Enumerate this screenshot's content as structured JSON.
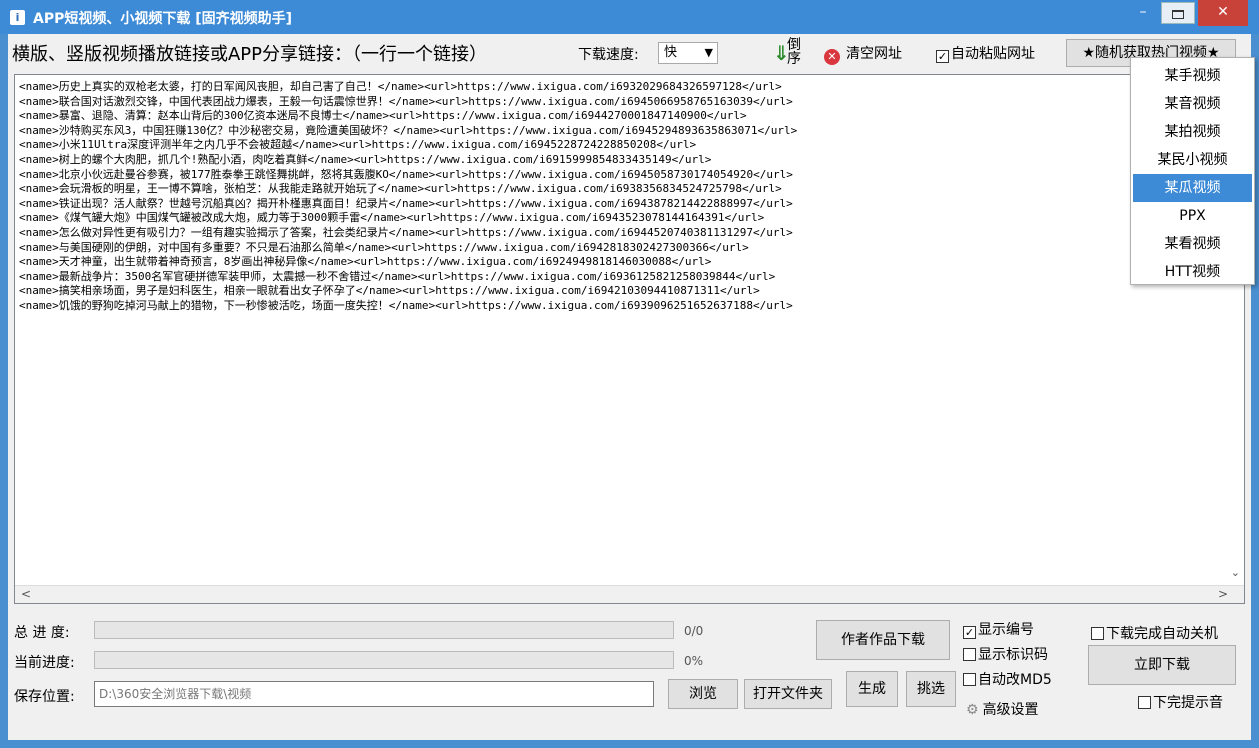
{
  "window": {
    "title": "APP短视频、小视频下载 [固齐视频助手]",
    "min": "–",
    "close": "✕"
  },
  "toolbar": {
    "hint": "横版、竖版视频播放链接或APP分享链接：（一行一个链接）",
    "speed_label": "下载速度:",
    "speed_value": "快",
    "reverse_label": "倒序",
    "clear_label": "清空网址",
    "autopaste_label": "自动粘贴网址",
    "hot_label": "★随机获取热门视频★"
  },
  "links": [
    "<name>历史上真实的双枪老太婆，打的日军闻风丧胆，却自己害了自己！</name><url>https://www.ixigua.com/i6932029684326597128</url>",
    "<name>联合国对话激烈交锋，中国代表团战力爆表，王毅一句话震惊世界！</name><url>https://www.ixigua.com/i6945066958765163039</url>",
    "<name>暴富、退隐、清算：赵本山背后的300亿资本迷局不良博士</name><url>https://www.ixigua.com/i6944270001847140900</url>",
    "<name>沙特购买东风3，中国狂赚130亿？中沙秘密交易，竟险遭美国破坏？</name><url>https://www.ixigua.com/i6945294893635863071</url>",
    "<name>小米11Ultra深度评测半年之内几乎不会被超越</name><url>https://www.ixigua.com/i6945228724228850208</url>",
    "<name>树上的螺个大肉肥，抓几个!熟配小酒，肉吃着真鲜</name><url>https://www.ixigua.com/i6915999854833435149</url>",
    "<name>北京小伙远赴曼谷参赛，被177胜泰拳王跳怪舞挑衅，怒将其轰腹KO</name><url>https://www.ixigua.com/i6945058730174054920</url>",
    "<name>会玩滑板的明星，王一博不算啥，张柏芝：从我能走路就开始玩了</name><url>https://www.ixigua.com/i6938356834524725798</url>",
    "<name>铁证出现？活人献祭？世越号沉船真凶？揭开朴槿惠真面目！纪录片</name><url>https://www.ixigua.com/i6943878214422888997</url>",
    "<name>《煤气罐大炮》中国煤气罐被改成大炮，威力等于3000颗手雷</name><url>https://www.ixigua.com/i6943523078144164391</url>",
    "<name>怎么做对异性更有吸引力？一组有趣实验揭示了答案，社会类纪录片</name><url>https://www.ixigua.com/i6944520740381131297</url>",
    "<name>与美国硬刚的伊朗，对中国有多重要？不只是石油那么简单</name><url>https://www.ixigua.com/i6942818302427300366</url>",
    "<name>天才神童，出生就带着神奇预言，8岁画出神秘异像</name><url>https://www.ixigua.com/i6924949818146030088</url>",
    "<name>最新战争片：3500名军官硬拼德军装甲师，太震撼一秒不舍错过</name><url>https://www.ixigua.com/i6936125821258039844</url>",
    "<name>搞笑相亲场面，男子是妇科医生，相亲一眼就看出女子怀孕了</name><url>https://www.ixigua.com/i6942103094410871311</url>",
    "<name>饥饿的野狗吃掉河马献上的猎物，下一秒惨被活吃，场面一度失控！</name><url>https://www.ixigua.com/i6939096251652637188</url>"
  ],
  "progress": {
    "total_label": "总 进 度:",
    "total_value": "0/0",
    "total_fraction": 0,
    "current_label": "当前进度:",
    "current_value": "0%",
    "current_fraction": 0
  },
  "save": {
    "label": "保存位置:",
    "path": "D:\\360安全浏览器下载\\视频"
  },
  "buttons": {
    "browse": "浏览",
    "open_folder": "打开文件夹",
    "author_download": "作者作品下载",
    "generate": "生成",
    "pick": "挑选",
    "download_now": "立即下载",
    "advanced": "高级设置"
  },
  "options": {
    "show_number": "显示编号",
    "show_number_checked": true,
    "show_id": "显示标识码",
    "show_id_checked": false,
    "auto_md5": "自动改MD5",
    "auto_md5_checked": false,
    "shutdown": "下载完成自动关机",
    "shutdown_checked": false,
    "sound": "下完提示音",
    "sound_checked": false
  },
  "dropdown": {
    "items": [
      "某手视频",
      "某音视频",
      "某拍视频",
      "某民小视频",
      "某瓜视频",
      "PPX",
      "某看视频",
      "HTT视频"
    ],
    "selected_index": 4
  }
}
